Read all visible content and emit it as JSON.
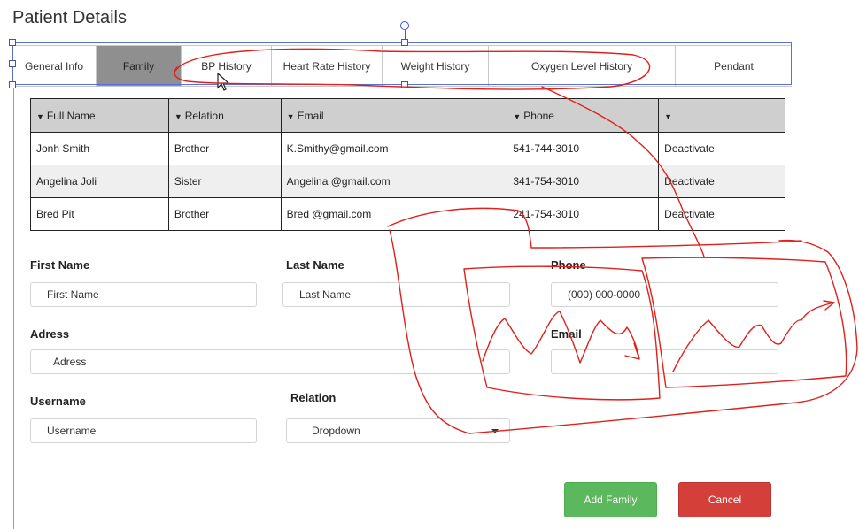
{
  "page": {
    "title": "Patient Details"
  },
  "tabs": [
    {
      "label": "General Info",
      "active": false
    },
    {
      "label": "Family",
      "active": true
    },
    {
      "label": "BP History",
      "active": false
    },
    {
      "label": "Heart Rate History",
      "active": false
    },
    {
      "label": "Weight History",
      "active": false
    },
    {
      "label": "Oxygen Level History",
      "active": false
    },
    {
      "label": "Pendant",
      "active": false
    }
  ],
  "table": {
    "columns": [
      "Full Name",
      "Relation",
      "Email",
      "Phone",
      ""
    ],
    "rows": [
      {
        "name": "Jonh Smith",
        "relation": "Brother",
        "email": "K.Smithy@gmail.com",
        "phone": "541-744-3010",
        "action": "Deactivate"
      },
      {
        "name": "Angelina Joli",
        "relation": "Sister",
        "email": "Angelina @gmail.com",
        "phone": "341-754-3010",
        "action": "Deactivate"
      },
      {
        "name": "Bred Pit",
        "relation": "Brother",
        "email": "Bred @gmail.com",
        "phone": "241-754-3010",
        "action": "Deactivate"
      }
    ]
  },
  "form": {
    "first_name": {
      "label": "First Name",
      "placeholder": "First Name"
    },
    "last_name": {
      "label": "Last Name",
      "placeholder": "Last Name"
    },
    "phone": {
      "label": "Phone",
      "placeholder": "(000) 000-0000"
    },
    "address": {
      "label": "Adress",
      "placeholder": "Adress"
    },
    "email": {
      "label": "Email",
      "placeholder": ""
    },
    "username": {
      "label": "Username",
      "placeholder": "Username"
    },
    "relation": {
      "label": "Relation",
      "value": "Dropdown"
    }
  },
  "buttons": {
    "add": "Add Family",
    "cancel": "Cancel"
  },
  "colors": {
    "active_tab": "#8f8f8f",
    "table_header": "#cfcfcf",
    "add_button": "#5cb85c",
    "cancel_button": "#d43f3a",
    "selection": "#3d53c9",
    "annotation": "#e0201b"
  },
  "icons": {
    "cursor": "mouse-pointer-icon",
    "sort": "caret-down-icon",
    "rotate": "rotate-handle-icon"
  }
}
